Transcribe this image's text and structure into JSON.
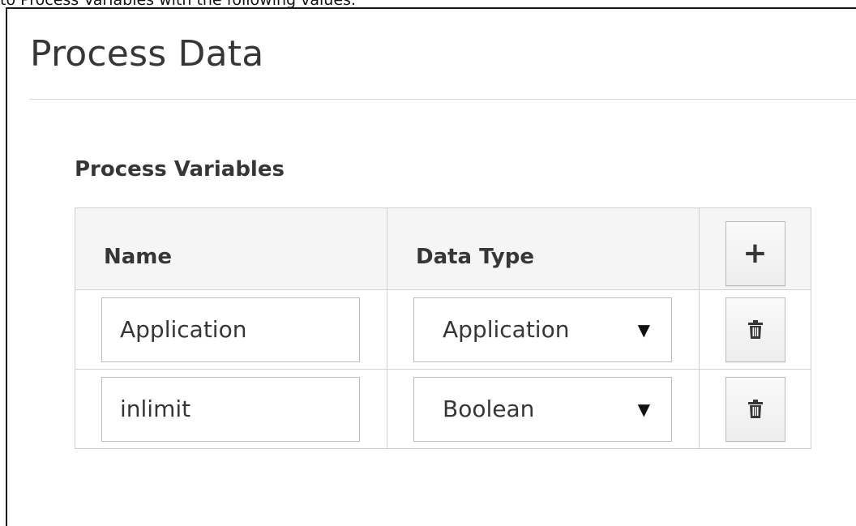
{
  "caption": "to Process Variables with the following values.",
  "panel": {
    "title": "Process Data"
  },
  "section": {
    "title": "Process Variables"
  },
  "table": {
    "headers": {
      "name": "Name",
      "data_type": "Data Type"
    },
    "rows": [
      {
        "name": "Application",
        "data_type": "Application"
      },
      {
        "name": "inlimit",
        "data_type": "Boolean"
      }
    ]
  },
  "icons": {
    "add": "plus-icon",
    "delete": "trash-icon",
    "dropdown": "caret-down-icon"
  }
}
